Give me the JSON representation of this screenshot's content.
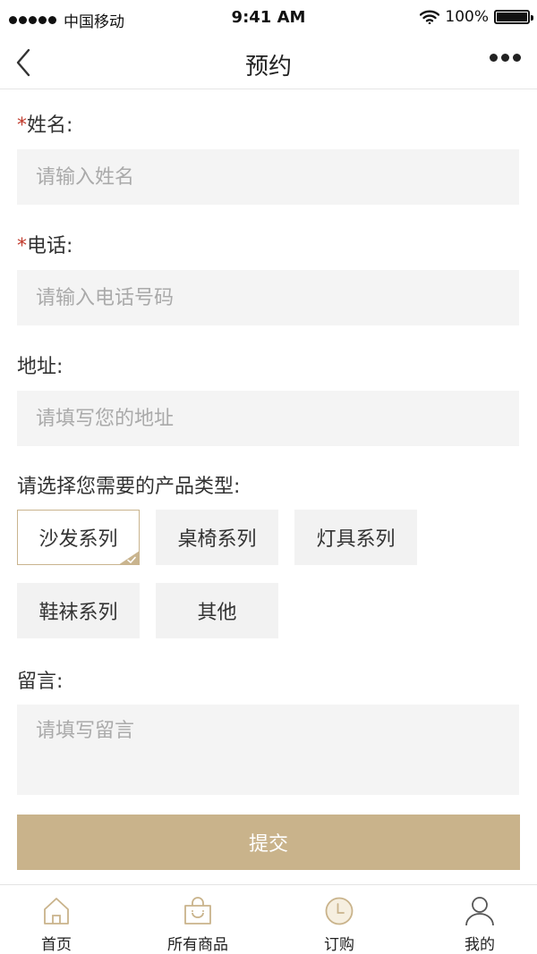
{
  "status_bar": {
    "carrier": "中国移动",
    "time": "9:41 AM",
    "battery": "100%",
    "battery_level": 1.0
  },
  "nav": {
    "title": "预约",
    "back_icon": "chevron-left-icon",
    "more_icon": "more-dots-icon"
  },
  "form": {
    "name": {
      "required_mark": "*",
      "label": "姓名:",
      "placeholder": "请输入姓名"
    },
    "phone": {
      "required_mark": "*",
      "label": "电话:",
      "placeholder": "请输入电话号码"
    },
    "address": {
      "label": "地址:",
      "placeholder": "请填写您的地址"
    },
    "category": {
      "label": "请选择您需要的产品类型:",
      "options": [
        "沙发系列",
        "桌椅系列",
        "灯具系列",
        "鞋袜系列",
        "其他"
      ],
      "selected": "沙发系列"
    },
    "message": {
      "label": "留言:",
      "placeholder": "请填写留言"
    },
    "submit_label": "提交"
  },
  "tabs": [
    {
      "label": "首页",
      "icon": "home-icon"
    },
    {
      "label": "所有商品",
      "icon": "shopping-bag-icon"
    },
    {
      "label": "订购",
      "icon": "clock-icon"
    },
    {
      "label": "我的",
      "icon": "user-icon"
    }
  ],
  "colors": {
    "accent": "#c9b38b",
    "required": "#c0392b",
    "input_bg": "#f4f4f4"
  }
}
